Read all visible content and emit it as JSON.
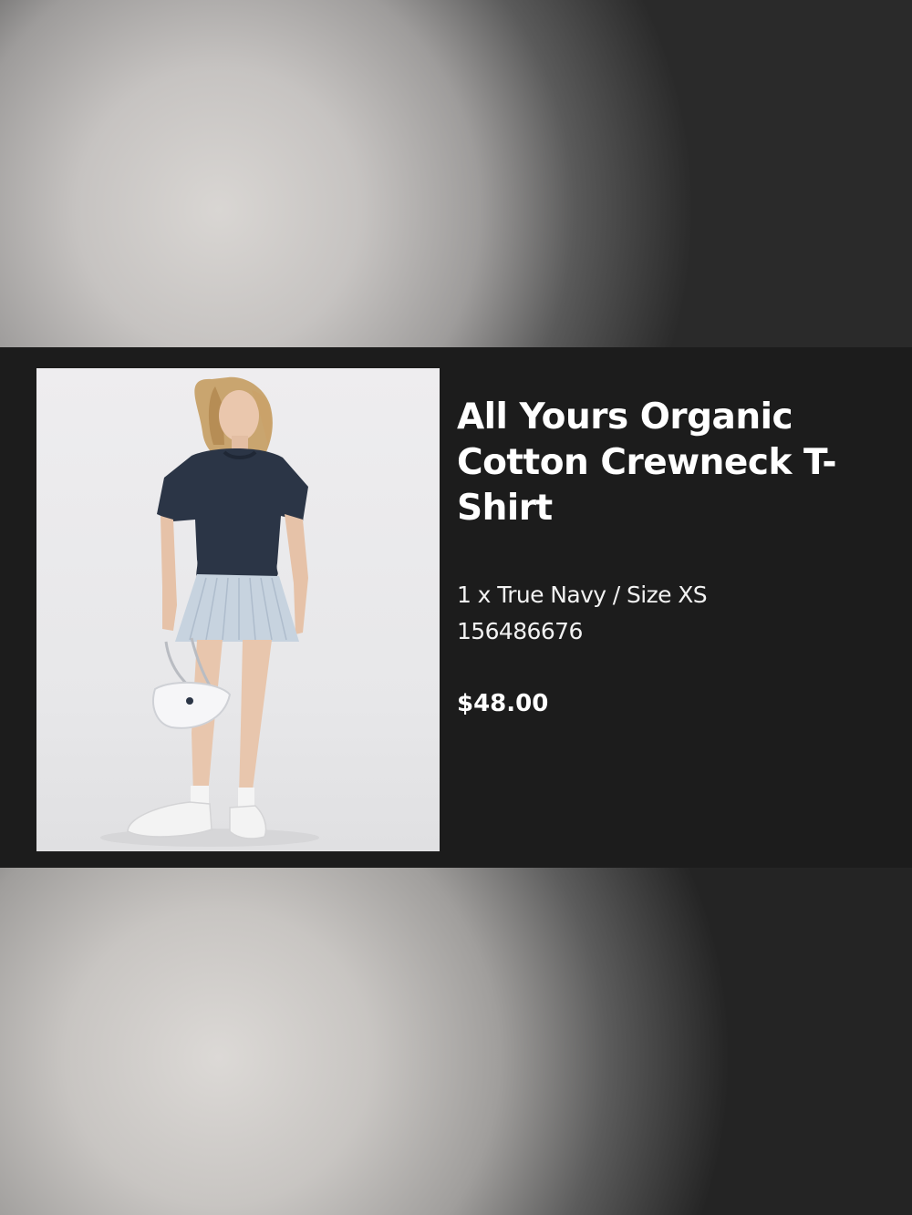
{
  "product": {
    "title": "All Yours Organic Cotton Crewneck T-Shirt",
    "variant": "1 x True Navy / Size XS",
    "sku": "156486676",
    "price": "$48.00"
  },
  "colors": {
    "card_background": "#1c1c1c",
    "image_background": "#eeedef",
    "text": "#ffffff"
  }
}
